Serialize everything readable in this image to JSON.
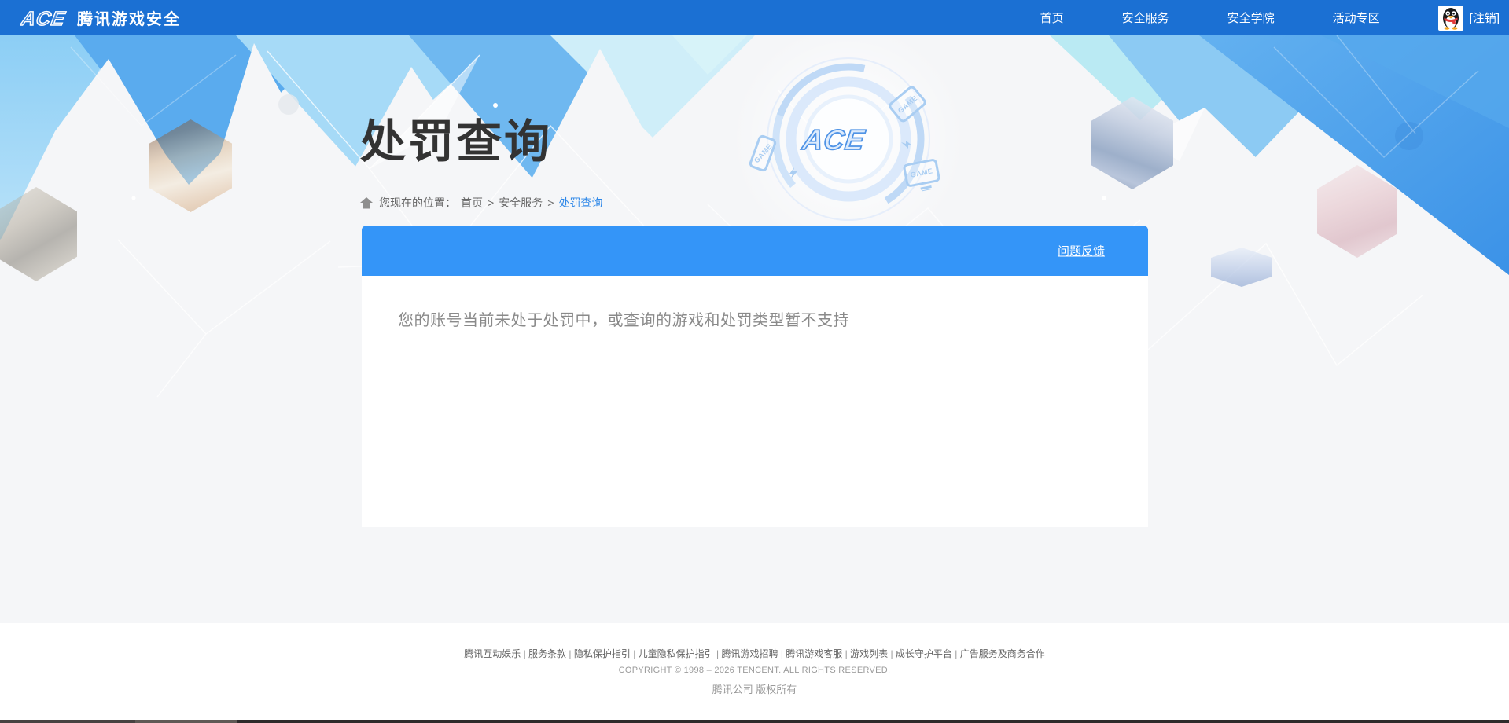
{
  "header": {
    "logo_text": "ACE",
    "brand": "腾讯游戏安全",
    "nav": [
      "首页",
      "安全服务",
      "安全学院",
      "活动专区"
    ],
    "logout_label": "[注销]"
  },
  "hero": {
    "title": "处罚查询",
    "breadcrumb": {
      "label": "您现在的位置：",
      "items": [
        "首页",
        "安全服务",
        "处罚查询"
      ],
      "separator": ">"
    },
    "badge_logo_text": "ACE",
    "game_chip_label": "GAME"
  },
  "panel": {
    "feedback_link": "问题反馈",
    "message": "您的账号当前未处于处罚中，或查询的游戏和处罚类型暂不支持"
  },
  "footer": {
    "links": [
      "腾讯互动娱乐",
      "服务条款",
      "隐私保护指引",
      "儿童隐私保护指引",
      "腾讯游戏招聘",
      "腾讯游戏客服",
      "游戏列表",
      "成长守护平台",
      "广告服务及商务合作"
    ],
    "separator": "|",
    "copyright": "COPYRIGHT © 1998 – 2026 TENCENT. ALL RIGHTS RESERVED.",
    "company": "腾讯公司 版权所有"
  },
  "colors": {
    "header_blue": "#1b70d3",
    "panel_blue": "#3495f8",
    "link_blue": "#2f88e8",
    "banner_blue": "#4aa0ea",
    "title_gray": "#333333",
    "message_gray": "#8a8a8a"
  }
}
